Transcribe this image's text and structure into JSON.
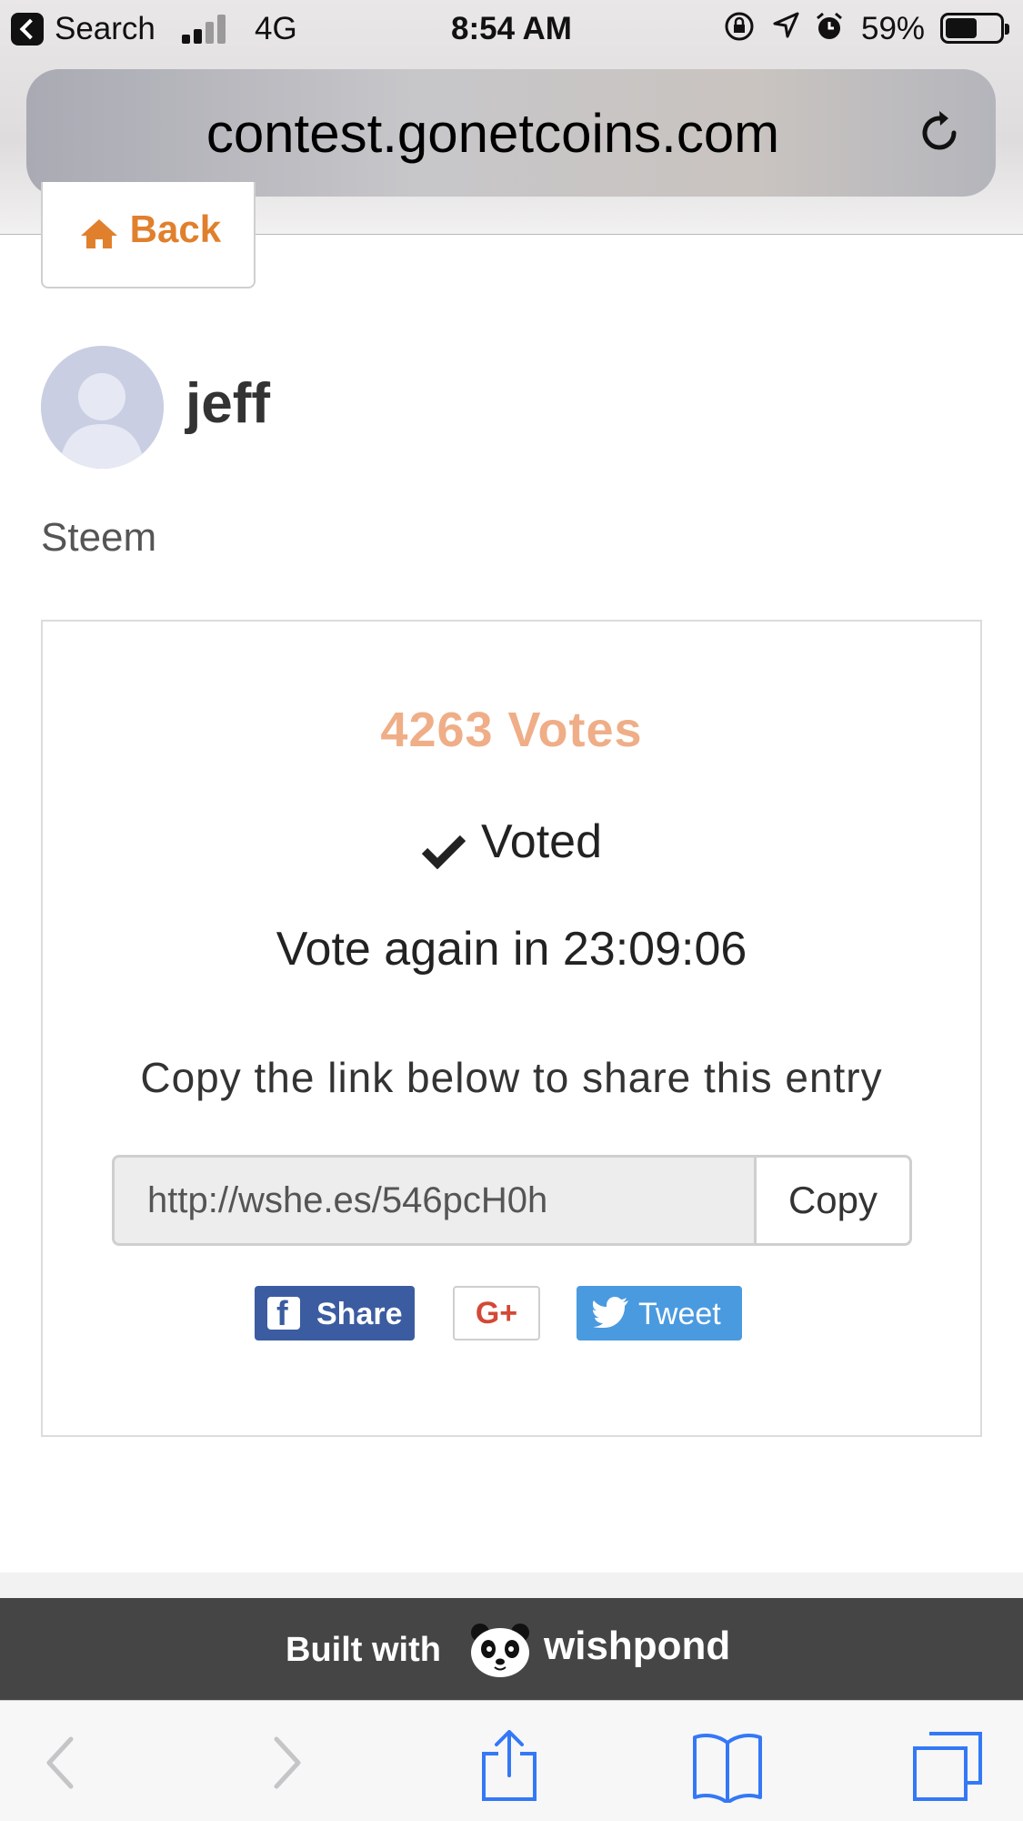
{
  "status_bar": {
    "back_app": "Search",
    "network": "4G",
    "time": "8:54 AM",
    "battery_percent": "59%",
    "battery_level": 0.59
  },
  "browser": {
    "url": "contest.gonetcoins.com"
  },
  "page": {
    "back_label": "Back",
    "username": "jeff",
    "category": "Steem",
    "votes_text": "4263 Votes",
    "voted_label": "Voted",
    "vote_again_text": "Vote again in 23:09:06",
    "copy_hint": "Copy the link below to share this entry",
    "share_link": "http://wshe.es/546pcH0h",
    "copy_button": "Copy",
    "facebook_button": "Share",
    "googleplus_button": "G+",
    "twitter_button": "Tweet"
  },
  "footer": {
    "built_with": "Built with",
    "brand": "wishpond"
  },
  "colors": {
    "accent_orange": "#e0802d",
    "votes_color": "#efae87",
    "facebook_blue": "#3b5ca0",
    "twitter_blue": "#4a9ae0",
    "google_red": "#d34836",
    "footer_bg": "#454545",
    "ios_blue": "#3478f6"
  }
}
